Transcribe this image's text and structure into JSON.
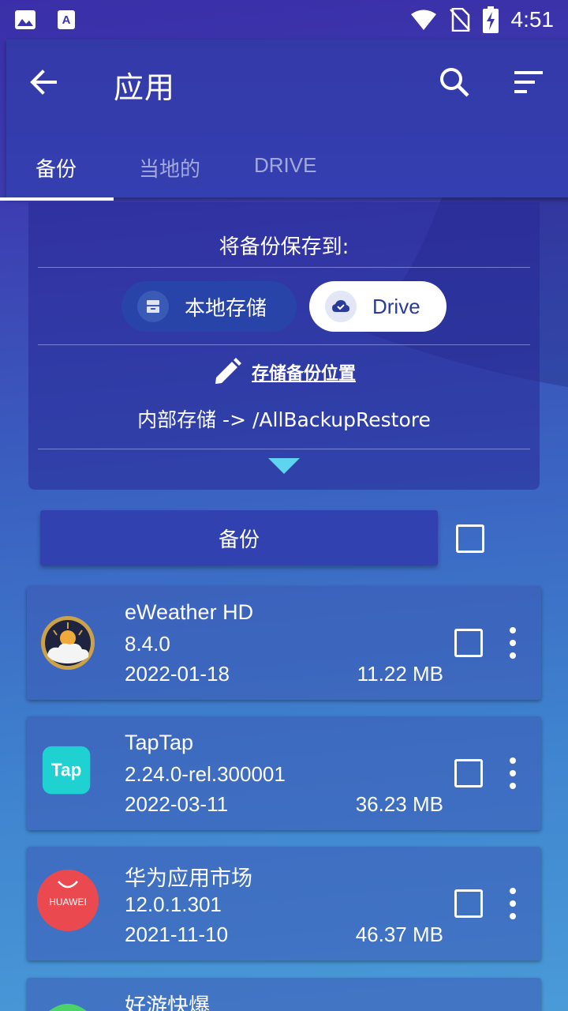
{
  "status_bar": {
    "time": "4:51",
    "icons": [
      "image-icon",
      "a-icon",
      "wifi-icon",
      "no-sim-icon",
      "battery-charging-icon"
    ]
  },
  "app_bar": {
    "title": "应用",
    "back_icon": "arrow-back-icon",
    "search_icon": "search-icon",
    "sort_icon": "sort-icon"
  },
  "tabs": [
    {
      "label": "备份",
      "active": true
    },
    {
      "label": "当地的",
      "active": false
    },
    {
      "label": "DRIVE",
      "active": false
    }
  ],
  "destination": {
    "title": "将备份保存到:",
    "options": [
      {
        "label": "本地存储",
        "icon": "storage-icon",
        "selected": false
      },
      {
        "label": "Drive",
        "icon": "cloud-done-icon",
        "selected": true
      }
    ],
    "location_label": "存储备份位置",
    "location_icon": "pencil-icon",
    "location_path": "内部存储 -> /AllBackupRestore"
  },
  "backup_button": {
    "label": "备份"
  },
  "apps": [
    {
      "name": "eWeather HD",
      "version": "8.4.0",
      "date": "2022-01-18",
      "size": "11.22 MB",
      "icon": "eweather-icon"
    },
    {
      "name": "TapTap",
      "version": "2.24.0-rel.300001",
      "date": "2022-03-11",
      "size": "36.23 MB",
      "icon": "taptap-icon",
      "icon_text": "Tap"
    },
    {
      "name": "华为应用市场",
      "version": "12.0.1.301",
      "date": "2021-11-10",
      "size": "46.37 MB",
      "icon": "huawei-icon",
      "icon_text": "HUAWEI"
    },
    {
      "name": "好游快爆",
      "icon": "haoyou-icon"
    }
  ],
  "colors": {
    "accent": "#3142b0",
    "app_bar": "#343ca8",
    "drive_chip_text": "#2a3a9a",
    "arrow": "#5fd4f0"
  }
}
